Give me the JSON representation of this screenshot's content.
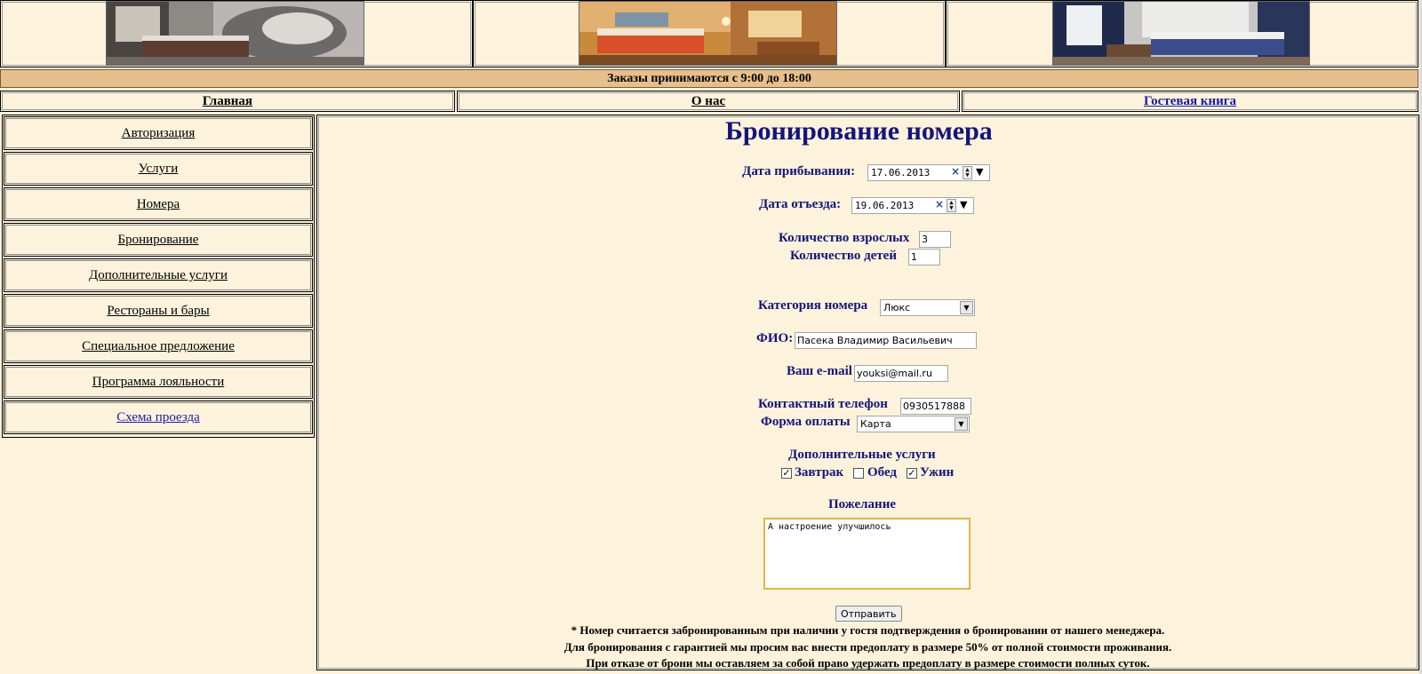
{
  "header": {
    "photos": [
      "bedroom-photo-1",
      "bedroom-photo-2",
      "bedroom-photo-3"
    ],
    "hours": "Заказы принимаются с 9:00 до 18:00"
  },
  "topnav": {
    "home": "Главная",
    "about": "О нас",
    "guestbook": "Гостевая книга"
  },
  "sidebar": {
    "items": [
      "Авторизация",
      "Услуги",
      "Номера",
      "Бронирование",
      "Дополнительные услуги",
      "Рестораны и бары",
      "Специальное предложение",
      "Программа лояльности",
      "Схема проезда"
    ]
  },
  "form": {
    "title": "Бронирование номера",
    "arrival_label": "Дата прибывания:",
    "arrival_value": "17.06.2013",
    "departure_label": "Дата отъезда:",
    "departure_value": "19.06.2013",
    "adults_label": "Количество взрослых",
    "adults_value": "3",
    "children_label": "Количество детей",
    "children_value": "1",
    "category_label": "Категория номера",
    "category_value": "Люкс",
    "name_label": "ФИО:",
    "name_value": "Пасека Владимир Васильевич",
    "email_label": "Ваш e-mail",
    "email_value": "youksi@mail.ru",
    "phone_label": "Контактный телефон",
    "phone_value": "0930517888",
    "payment_label": "Форма оплаты",
    "payment_value": "Карта",
    "extras_label": "Дополнительные услуги",
    "extras": [
      {
        "label": "Завтрак",
        "checked": true
      },
      {
        "label": "Обед",
        "checked": false
      },
      {
        "label": "Ужин",
        "checked": true
      }
    ],
    "wish_label": "Пожелание",
    "wish_value": "А настроение улучшилось",
    "submit": "Отправить"
  },
  "notes": [
    "* Номер считается забронированным при наличии у гостя подтверждения о бронировании от нашего менеджера.",
    "Для бронирования с гарантией мы просим вас внести предоплату в размере 50% от полной стоимости проживания.",
    "При отказе от брони мы оставляем за собой право удержать предоплату в размере стоимости полных суток."
  ],
  "colors": {
    "background": "#fdf3dc",
    "hours_bar": "#e7bf8c",
    "heading": "#14147a",
    "link_blue": "#1a1aa8"
  }
}
